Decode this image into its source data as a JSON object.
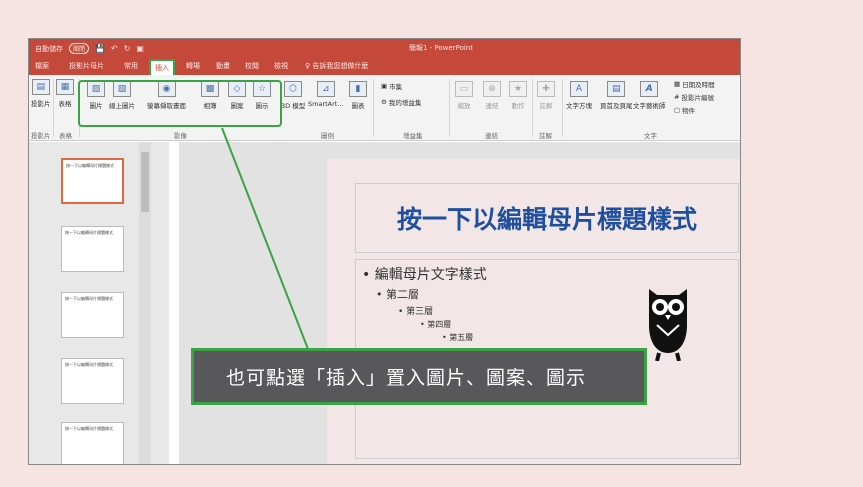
{
  "titlebar": {
    "autosave": "自動儲存",
    "autosave_state": "關閉",
    "title": "簡報1 - PowerPoint"
  },
  "tabs": [
    {
      "label": "檔案"
    },
    {
      "label": "投影片母片"
    },
    {
      "label": "常用"
    },
    {
      "label": "插入",
      "active": true
    },
    {
      "label": "轉場"
    },
    {
      "label": "動畫"
    },
    {
      "label": "校閱"
    },
    {
      "label": "檢視"
    },
    {
      "label": "告訴我您想做什麼",
      "icon": "lightbulb-icon"
    }
  ],
  "ribbon": {
    "buttons": {
      "new_slide": "投影片",
      "table": "表格",
      "pictures": "圖片",
      "online_pictures": "線上圖片",
      "screenshot": "螢幕擷取畫面",
      "album": "相簿",
      "shapes": "圖案",
      "icons": "圖示",
      "model3d": "3D 模型",
      "smartart": "SmartArt...",
      "chart": "圖表",
      "store": "市集",
      "my_addins": "我的增益集",
      "zoom": "縮放",
      "link": "連結",
      "action": "動作",
      "comment": "註解",
      "textbox": "文字方塊",
      "header_footer": "頁首及頁尾",
      "wordart": "文字藝術師",
      "datetime": "日期及時間",
      "slide_number": "投影片編號",
      "object": "物件"
    },
    "groups": {
      "slides": "投影片",
      "tables": "表格",
      "images": "影像",
      "illustrations": "圖例",
      "addins": "增益集",
      "links": "連結",
      "comments": "註解",
      "text": "文字"
    }
  },
  "thumbnails": [
    {
      "text": "按一下以編輯母片標題樣式"
    },
    {
      "text": "按一下以編輯母片標題樣式"
    },
    {
      "text": "按一下以編輯母片標題樣式"
    },
    {
      "text": "按一下以編輯母片標題樣式"
    },
    {
      "text": "按一下以編輯母片標題樣式"
    }
  ],
  "slide": {
    "title": "按一下以編輯母片標題樣式",
    "levels": [
      "編輯母片文字樣式",
      "第二層",
      "第三層",
      "第四層",
      "第五層"
    ]
  },
  "callout": {
    "text": "也可點選「插入」置入圖片、圖案、圖示"
  },
  "colors": {
    "title_bar": "#c5493a",
    "highlight": "#3aa346",
    "title_text": "#1f4f9f"
  }
}
